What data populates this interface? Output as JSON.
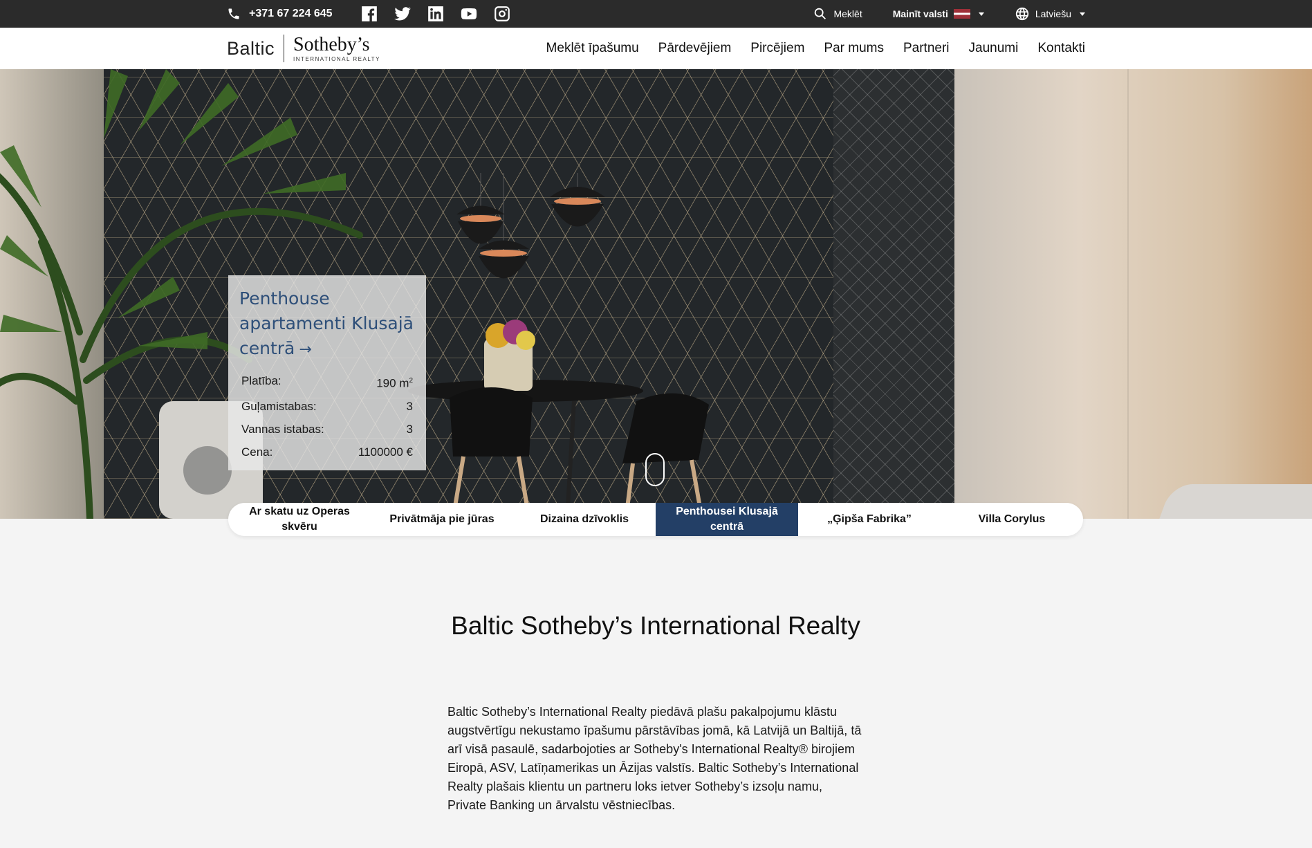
{
  "topbar": {
    "phone": "+371 67 224 645",
    "social_icons": [
      "facebook-icon",
      "twitter-icon",
      "linkedin-icon",
      "youtube-icon",
      "instagram-icon"
    ],
    "search_label": "Meklēt",
    "country_label": "Mainīt valsti",
    "language_label": "Latviešu"
  },
  "header": {
    "logo_baltic": "Baltic",
    "logo_sothebys": "Sotheby’s",
    "logo_sub": "INTERNATIONAL REALTY",
    "nav": [
      "Meklēt īpašumu",
      "Pārdevējiem",
      "Pircējiem",
      "Par mums",
      "Partneri",
      "Jaunumi",
      "Kontakti"
    ]
  },
  "hero_card": {
    "title": "Penthouse apartamenti Klusajā centrā",
    "arrow": "→",
    "rows": [
      {
        "label": "Platība:",
        "value": "190 m",
        "sup": "2"
      },
      {
        "label": "Guļamistabas:",
        "value": "3"
      },
      {
        "label": "Vannas istabas:",
        "value": "3"
      },
      {
        "label": "Cena:",
        "value": "1100000 €"
      }
    ]
  },
  "tabs": [
    {
      "label": "Ar skatu uz Operas skvēru"
    },
    {
      "label": "Privātmāja pie jūras"
    },
    {
      "label": "Dizaina dzīvoklis"
    },
    {
      "label": "Penthousei Klusajā centrā"
    },
    {
      "label": "„Ģipša Fabrika”"
    },
    {
      "label": "Villa Corylus"
    }
  ],
  "active_tab_index": 3,
  "intro": {
    "title": "Baltic Sotheby’s International Realty",
    "text": "Baltic Sotheby’s International Realty piedāvā plašu pakalpojumu klāstu augstvērtīgu nekustamo īpašumu pārstāvības jomā, kā Latvijā un Baltijā, tā arī visā pasaulē, sadarbojoties ar Sotheby's International Realty® birojiem Eiropā, ASV, Latīņamerikas un Āzijas valstīs. Baltic Sotheby’s International Realty plašais klientu un partneru loks ietver Sotheby’s izsoļu namu, Private Banking un ārvalstu vēstniecības."
  },
  "colors": {
    "topbar_bg": "#2b2b2b",
    "accent_blue": "#233f66",
    "card_title": "#2e4f79",
    "page_bg": "#f4f4f4"
  }
}
